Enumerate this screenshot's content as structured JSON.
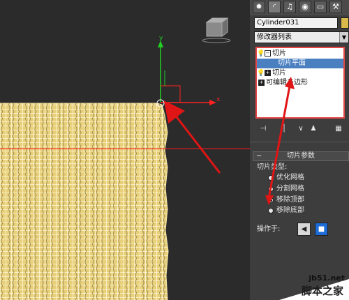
{
  "viewport": {
    "gizmo": {
      "y_label": "y",
      "x_label": "x"
    },
    "colors": {
      "mesh": "#e8d07a",
      "mesh_line": "#ffffff",
      "slice_line": "#ff1a1a",
      "arrow": "#e01515",
      "axis_y": "#22cc22",
      "axis_x": "#ff2222"
    }
  },
  "panel": {
    "tabs": [
      {
        "icon": "create-icon",
        "glyph": "✹"
      },
      {
        "icon": "modify-icon",
        "glyph": "◜"
      },
      {
        "icon": "hierarchy-icon",
        "glyph": "♫"
      },
      {
        "icon": "motion-icon",
        "glyph": "◉"
      },
      {
        "icon": "display-icon",
        "glyph": "▭"
      },
      {
        "icon": "utilities-icon",
        "glyph": "⚒"
      }
    ],
    "object_name": "Cylinder031",
    "object_color": "#d9b94b",
    "modifier_list": "修改器列表",
    "stack": [
      {
        "label": "切片",
        "icon": "lightbulb-icon",
        "box": "⊟",
        "selected": false
      },
      {
        "label": "切片平面",
        "icon": "",
        "box": "",
        "selected": true
      },
      {
        "label": "切片",
        "icon": "lightbulb-icon",
        "box": "⊞",
        "selected": false
      },
      {
        "label": "可编辑多边形",
        "icon": "",
        "box": "■",
        "selected": false
      }
    ],
    "rollout": {
      "title": "切片参数",
      "type_label": "切片类型:",
      "options": [
        {
          "label": "优化网格",
          "checked": false
        },
        {
          "label": "分割网格",
          "checked": false
        },
        {
          "label": "移除顶部",
          "checked": true
        },
        {
          "label": "移除底部",
          "checked": false
        }
      ],
      "operate_label": "操作于:"
    }
  },
  "watermark": {
    "url": "jb51.net",
    "text": "脚本之家"
  }
}
